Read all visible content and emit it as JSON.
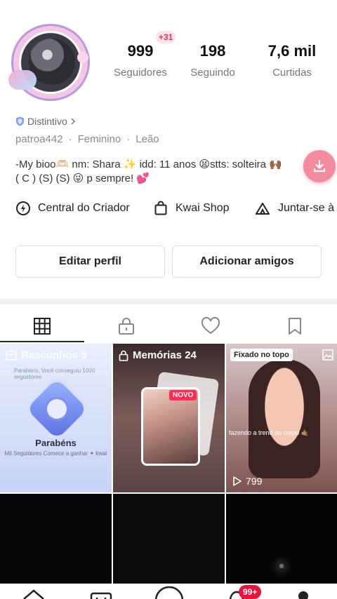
{
  "profile": {
    "stats": {
      "followers_value": "999",
      "followers_label": "Seguidores",
      "followers_new": "+31",
      "following_value": "198",
      "following_label": "Seguindo",
      "likes_value": "7,6 mil",
      "likes_label": "Curtidas"
    },
    "badge_label": "Distintivo",
    "username": "patroa442",
    "gender": "Feminino",
    "sign": "Leão",
    "bio": "-My bioo🫶🏻 nm: Shara ✨   idd: 11 anos 😫stts: solteira 🙌🏾\n( C ) (S) (S) 😜 p sempre! 💕"
  },
  "shortcuts": {
    "creator": "Central do Criador",
    "shop": "Kwai Shop",
    "join": "Juntar-se à"
  },
  "actions": {
    "edit": "Editar perfil",
    "add_friends": "Adicionar amigos"
  },
  "grid": {
    "drafts_label": "Rascunhos 5",
    "drafts_title": "Parabéns",
    "drafts_note": "Mil Seguidores Comece a ganhar ✦ kwai",
    "drafts_sub": "Parabéns, Você conseguiu 1000 seguidores",
    "memories_label": "Memórias 24",
    "new_badge": "NOVO",
    "pinned_label": "Fixado no topo",
    "pinned_caption": "fazendo a trend do corpo 🤙🏽",
    "pinned_views": "799"
  },
  "nav": {
    "notifications_badge": "99+"
  },
  "colors": {
    "accent": "#e8143c",
    "fab": "#f28aa0"
  }
}
